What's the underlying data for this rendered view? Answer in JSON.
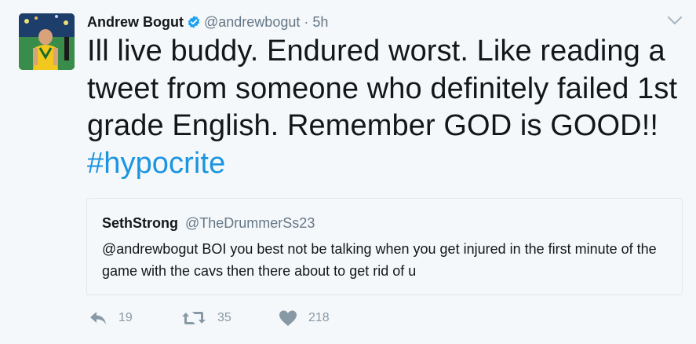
{
  "author": {
    "name": "Andrew Bogut",
    "handle": "@andrewbogut",
    "separator": "·",
    "time": "5h"
  },
  "tweet": {
    "text": "Ill live buddy. Endured worst. Like reading a tweet from someone who definitely failed 1st grade English. Remember GOD is GOOD!! ",
    "hashtag": "#hypocrite"
  },
  "quoted": {
    "name": "SethStrong",
    "handle": "@TheDrummerSs23",
    "text": "@andrewbogut BOI you best not be talking when you get injured in the first minute of the game with the cavs then there about to get rid of u"
  },
  "actions": {
    "replies": "19",
    "retweets": "35",
    "likes": "218"
  },
  "colors": {
    "background": "#f5f8fa",
    "link": "#1b95e0",
    "muted": "#657786",
    "icon": "#8899a6",
    "verified": "#1da1f2"
  },
  "icons": {
    "verified": "verified-badge-icon",
    "caret": "chevron-down-icon",
    "reply": "reply-icon",
    "retweet": "retweet-icon",
    "like": "heart-icon"
  }
}
